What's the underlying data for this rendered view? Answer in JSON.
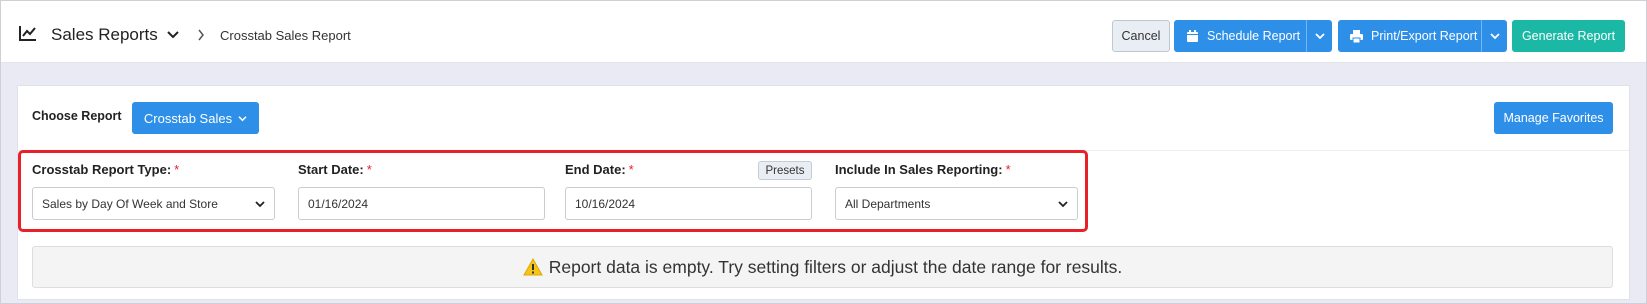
{
  "header": {
    "title": "Sales Reports",
    "breadcrumb": "Crosstab Sales Report",
    "icons": {
      "chart": "chart-line-icon",
      "title_caret": "chevron-down-icon",
      "breadcrumb_sep": "chevron-right-icon"
    }
  },
  "toolbar": {
    "cancel_label": "Cancel",
    "schedule_label": "Schedule Report",
    "print_label": "Print/Export Report",
    "generate_label": "Generate Report"
  },
  "report_chooser": {
    "label": "Choose Report",
    "selected": "Crosstab Sales",
    "manage_favorites_label": "Manage Favorites"
  },
  "filters": {
    "report_type": {
      "label": "Crosstab Report Type:",
      "value": "Sales by Day Of Week and Store"
    },
    "start_date": {
      "label": "Start Date:",
      "value": "01/16/2024"
    },
    "end_date": {
      "label": "End Date:",
      "value": "10/16/2024",
      "presets_label": "Presets"
    },
    "sales_reporting": {
      "label": "Include In Sales Reporting:",
      "value": "All Departments"
    },
    "required_marker": "*"
  },
  "empty_state": {
    "message": "Report data is empty. Try setting filters or adjust the date range for results."
  },
  "colors": {
    "primary": "#2e8fe8",
    "teal": "#1bb8a6",
    "highlight": "#e8202a",
    "band": "#e9eaf3"
  }
}
